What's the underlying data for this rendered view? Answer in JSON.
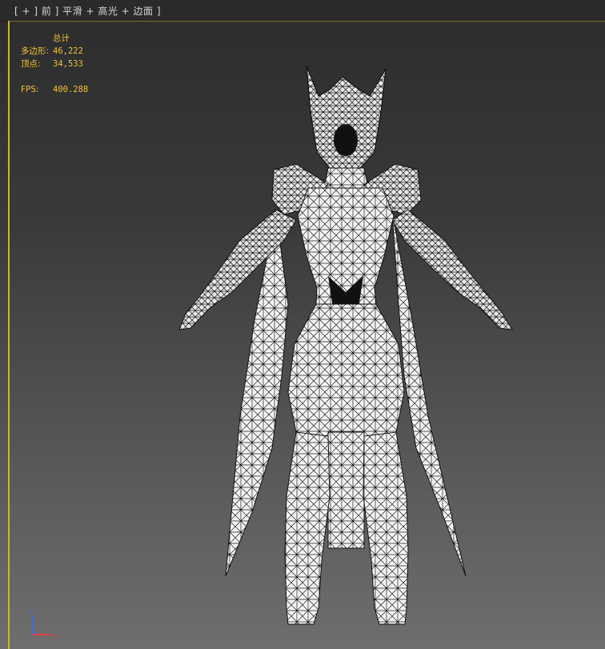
{
  "viewport": {
    "menu_label": "[ + ] 前 ] 平滑 + 高光 + 边面 ]",
    "frame_color": "#d1b233",
    "stats_color": "#f0c23a",
    "stats": {
      "total_label": "总计",
      "polygons_label": "多边形:",
      "polygons_value": "46,222",
      "vertices_label": "顶点:",
      "vertices_value": "34,533",
      "fps_label": "FPS:",
      "fps_value": "400.288"
    },
    "gizmo": {
      "x_label": "x",
      "z_label": "z"
    }
  }
}
